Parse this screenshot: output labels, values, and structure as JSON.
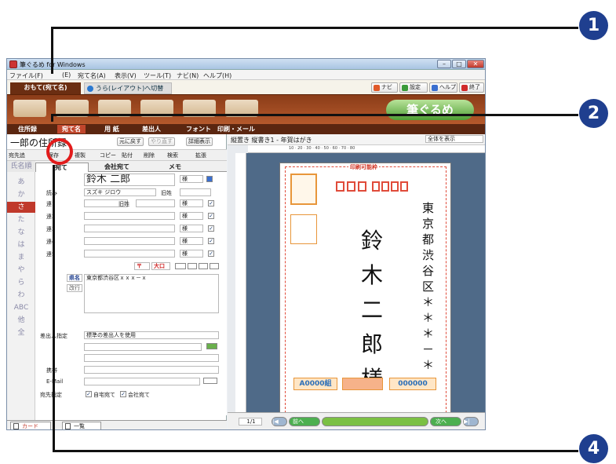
{
  "window": {
    "title": "筆ぐるめ for Windows",
    "controls": [
      "–",
      "□",
      "✕"
    ]
  },
  "menu": [
    "ファイル(F)",
    "(E)",
    "宛て名(A)",
    "表示(V)",
    "ツール(T)",
    "ナビ(N)",
    "ヘルプ(H)"
  ],
  "tabs": {
    "front": "おもて(宛て名)",
    "back": "うら(レイアウト)へ切替"
  },
  "toolbar_right": {
    "navi": "ナビ",
    "settings": "設定",
    "help": "ヘルプ",
    "exit": "終了"
  },
  "banner": "筆ぐるめ",
  "nav": {
    "items": [
      "住所録",
      "宛て名",
      "用 紙",
      "差出人",
      "フォント",
      "印刷・メール"
    ]
  },
  "address_book": {
    "title": "一郎の住所録",
    "undo": "元に戻す",
    "redo": "やり直す",
    "detail": "詳細表示",
    "tools": [
      "宛先追",
      "保存",
      "複製",
      "コピー",
      "貼付",
      "削除",
      "検索",
      "拡張"
    ],
    "sort": "氏名順",
    "kana": [
      "あ",
      "か",
      "さ",
      "た",
      "な",
      "は",
      "ま",
      "や",
      "ら",
      "わ",
      "ABC",
      "他",
      "全"
    ],
    "form_tabs": [
      "宛て",
      "会社宛て",
      "メモ"
    ],
    "name": "鈴木 二郎",
    "honorific": "様",
    "reading_label": "読み",
    "reading": "スズキ ジロウ",
    "old_surname": "旧姓",
    "joint_labels": [
      "連1",
      "連2",
      "連3",
      "連4",
      "連5"
    ],
    "postal_icons": [
      "〒",
      "大口"
    ],
    "pref_btn": "県名",
    "newline_btn": "改行",
    "address": "東京都渋谷区ｘｘｘ－ｘ",
    "sender_label": "差出人指定",
    "sender": "標準の差出人を使用",
    "mobile_label": "携帯",
    "email_label": "E-Mail",
    "dest_label": "宛先指定",
    "dest_home": "自宅宛て",
    "dest_company": "会社宛て",
    "bottom_tabs": [
      "カード",
      "一覧"
    ]
  },
  "preview": {
    "header": "縦置き 縦書き1 - 年賀はがき",
    "zoom": "全体を表示",
    "ruler": "10 · 20 · 30 · 40 · 50 · 60 · 70 · 80",
    "printable": "印刷可能枠",
    "address": "東京都渋谷区＊＊＊－＊",
    "name": "鈴木二郎様",
    "lottery": [
      "A0000組",
      "000000"
    ],
    "page": "1/1",
    "prev": "前へ",
    "next": "次へ"
  },
  "callouts": [
    "1",
    "2",
    "4"
  ]
}
